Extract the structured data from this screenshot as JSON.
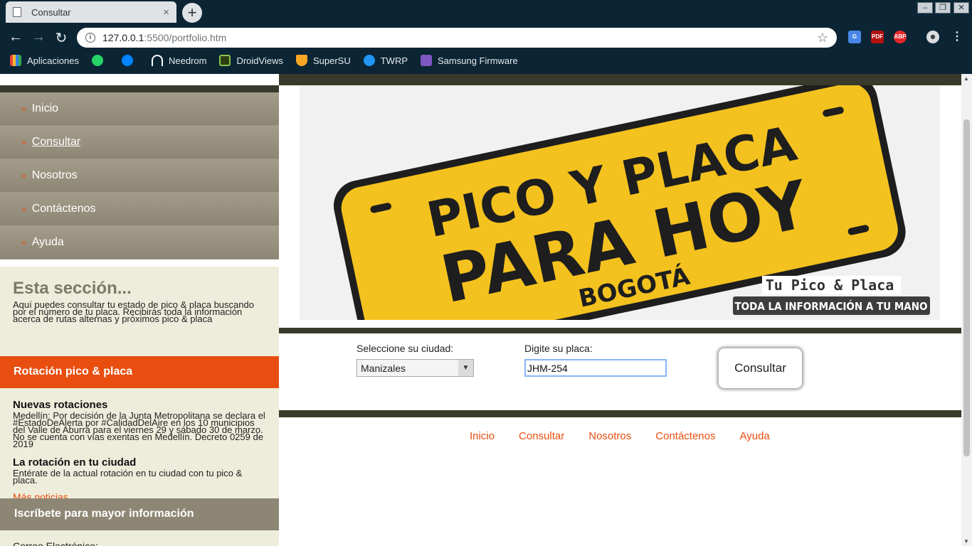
{
  "browser": {
    "tab_title": "Consultar",
    "tab_close": "×",
    "new_tab": "+",
    "url_host": "127.0.0.1",
    "url_path": ":5500/portfolio.htm",
    "bookmarks": [
      {
        "label": "Aplicaciones",
        "icon": "apps-grid-icon",
        "color": "#e8453c"
      },
      {
        "label": "",
        "icon": "whatsapp-icon",
        "color": "#25d366"
      },
      {
        "label": "",
        "icon": "messenger-icon",
        "color": "#0084ff"
      },
      {
        "label": "Needrom",
        "icon": "needrom-icon",
        "color": "#ffffff"
      },
      {
        "label": "DroidViews",
        "icon": "droidviews-icon",
        "color": "#8bc34a"
      },
      {
        "label": "SuperSU",
        "icon": "supersu-icon",
        "color": "#f5a623"
      },
      {
        "label": "TWRP",
        "icon": "twrp-icon",
        "color": "#2196f3"
      },
      {
        "label": "Samsung Firmware",
        "icon": "samsung-firmware-icon",
        "color": "#7e57c2"
      }
    ]
  },
  "sidebar": {
    "menu": [
      {
        "label": "Inicio"
      },
      {
        "label": "Consultar"
      },
      {
        "label": "Nosotros"
      },
      {
        "label": "Contáctenos"
      },
      {
        "label": "Ayuda"
      }
    ],
    "section_title": "Esta sección...",
    "section_text": "Aquí puedes consultar tu estado de pico & placa buscando por el número de tu placa. Recibirás toda la información acerca de rutas alternas y próximos pico & placa",
    "rotation_heading": "Rotación pico & placa",
    "news": [
      {
        "title": "Nuevas rotaciones",
        "text": "Medellín: Por decisión de la Junta Metropolitana se declara el #EstadoDeAlerta por #CalidadDelAire en los 10 municipios del Valle de Aburrá para el viernes 29 y sábado 30 de marzo. No se cuenta con vías exentas en Medellín. Decreto 0259 de 2019"
      },
      {
        "title": "La rotación en tu ciudad",
        "text": "Entérate de la actual rotación en tu ciudad con tu pico & placa."
      }
    ],
    "more_news": "Más noticias",
    "subscribe_heading": "Iscríbete para mayor información",
    "email_label": "Correo Electrónico:"
  },
  "banner": {
    "line1": "PICO Y PLACA",
    "line2": "PARA HOY",
    "city": "BOGOTÁ",
    "slogan1": "Tu Pico & Placa",
    "slogan2": "TODA LA INFORMACIÓN A TU MANO"
  },
  "form": {
    "city_label": "Seleccione su ciudad:",
    "city_value": "Manizales",
    "plate_label": "Digite su placa:",
    "plate_value": "JHM-254",
    "submit_label": "Consultar"
  },
  "footer": {
    "links": [
      "Inicio",
      "Consultar",
      "Nosotros",
      "Contáctenos",
      "Ayuda"
    ]
  },
  "colors": {
    "accent": "#e84e0f",
    "menu_bg": "#8d8674",
    "dark_bar": "#3a3a2c",
    "sidebar_bg": "#eeeddc",
    "plate_yellow": "#f4c21f"
  }
}
